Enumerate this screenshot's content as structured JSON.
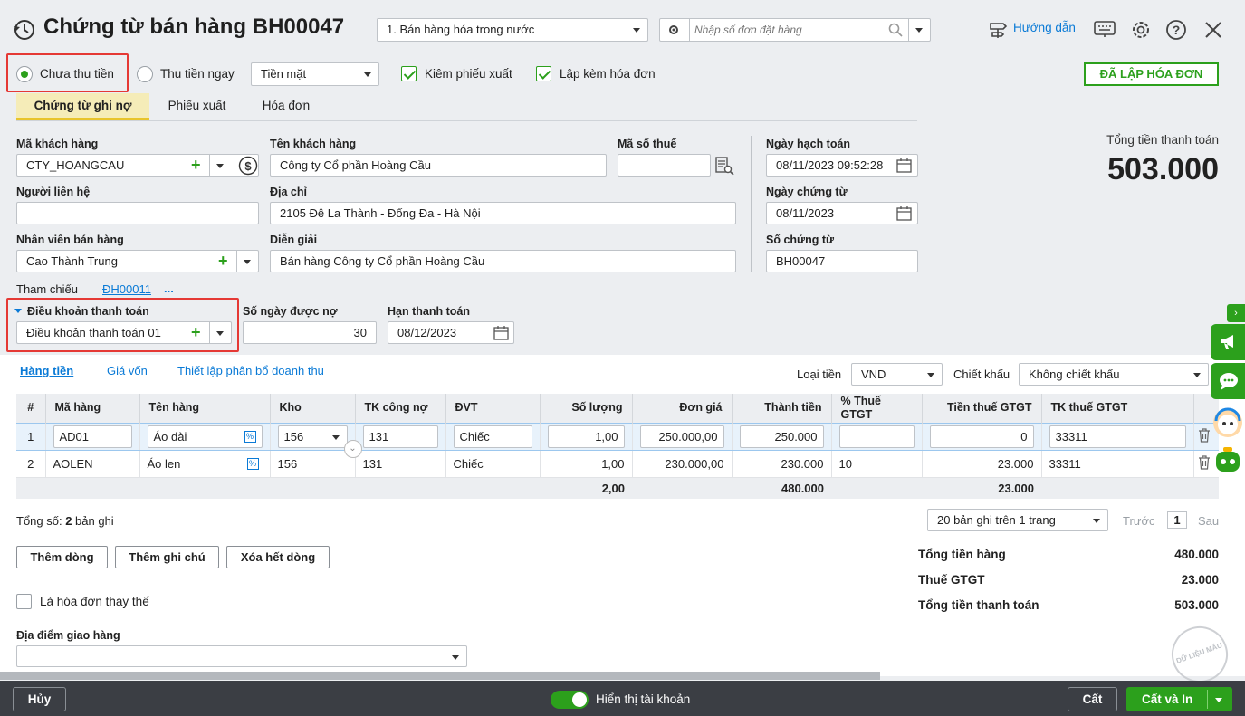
{
  "header": {
    "title": "Chứng từ bán hàng BH00047",
    "sale_type": "1. Bán hàng hóa trong nước",
    "order_search_placeholder": "Nhập số đơn đặt hàng",
    "help_label": "Hướng dẫn"
  },
  "payment": {
    "unpaid_label": "Chưa thu tiền",
    "paid_label": "Thu tiền ngay",
    "method": "Tiền mặt",
    "with_delivery_label": "Kiêm phiếu xuất",
    "with_invoice_label": "Lập kèm hóa đơn",
    "invoice_status": "ĐÃ LẬP HÓA ĐƠN"
  },
  "tabs": [
    "Chứng từ ghi nợ",
    "Phiếu xuất",
    "Hóa đơn"
  ],
  "form": {
    "customer_code_label": "Mã khách hàng",
    "customer_code": "CTY_HOANGCAU",
    "customer_name_label": "Tên khách hàng",
    "customer_name": "Công ty Cổ phần Hoàng Cầu",
    "tax_code_label": "Mã số thuế",
    "tax_code": "",
    "contact_label": "Người liên hệ",
    "contact": "",
    "address_label": "Địa chỉ",
    "address": "2105 Đê La Thành - Đống Đa - Hà Nội",
    "salesperson_label": "Nhân viên bán hàng",
    "salesperson": "Cao Thành Trung",
    "description_label": "Diễn giải",
    "description": "Bán hàng Công ty Cổ phần Hoàng Cầu",
    "posting_date_label": "Ngày hạch toán",
    "posting_date": "08/11/2023 09:52:28",
    "voucher_date_label": "Ngày chứng từ",
    "voucher_date": "08/11/2023",
    "voucher_no_label": "Số chứng từ",
    "voucher_no": "BH00047",
    "reference_label": "Tham chiếu",
    "reference": "ĐH00011",
    "reference_more": "...",
    "payment_terms_label": "Điều khoản thanh toán",
    "payment_terms": "Điều khoản thanh toán 01",
    "credit_days_label": "Số ngày được nợ",
    "credit_days": "30",
    "due_date_label": "Hạn thanh toán",
    "due_date": "08/12/2023"
  },
  "summary_top": {
    "total_label": "Tổng tiền thanh toán",
    "total": "503.000"
  },
  "detail_tabs": [
    "Hàng tiền",
    "Giá vốn",
    "Thiết lập phân bổ doanh thu"
  ],
  "currency_label": "Loại tiền",
  "currency": "VND",
  "discount_label": "Chiết khấu",
  "discount": "Không chiết khấu",
  "table": {
    "columns": [
      "#",
      "Mã hàng",
      "Tên hàng",
      "Kho",
      "TK công nợ",
      "ĐVT",
      "Số lượng",
      "Đơn giá",
      "Thành tiền",
      "% Thuế GTGT",
      "Tiền thuế GTGT",
      "TK thuế GTGT"
    ],
    "rows": [
      [
        "1",
        "AD01",
        "Áo dài",
        "156",
        "131",
        "Chiếc",
        "1,00",
        "250.000,00",
        "250.000",
        "",
        "0",
        "33311"
      ],
      [
        "2",
        "AOLEN",
        "Áo len",
        "156",
        "131",
        "Chiếc",
        "1,00",
        "230.000,00",
        "230.000",
        "10",
        "23.000",
        "33311"
      ]
    ],
    "totals": {
      "quantity": "2,00",
      "amount": "480.000",
      "vat": "23.000"
    }
  },
  "record_count_prefix": "Tổng số: ",
  "record_count": "2",
  "record_count_suffix": " bản ghi",
  "pager": {
    "per_page": "20 bản ghi trên 1 trang",
    "prev": "Trước",
    "page": "1",
    "next": "Sau"
  },
  "buttons": {
    "add_row": "Thêm dòng",
    "add_note": "Thêm ghi chú",
    "delete_all": "Xóa hết dòng"
  },
  "replacement_invoice_label": "Là hóa đơn thay thế",
  "delivery_place_label": "Địa điểm giao hàng",
  "totals": {
    "goods_label": "Tổng tiền hàng",
    "goods": "480.000",
    "vat_label": "Thuế GTGT",
    "vat": "23.000",
    "payment_label": "Tổng tiền thanh toán",
    "payment": "503.000"
  },
  "footer": {
    "cancel": "Hủy",
    "show_accounts_label": "Hiển thị tài khoản",
    "save": "Cất",
    "save_print": "Cất và In"
  },
  "watermark": "DỮ LIỆU MẪU",
  "colors": {
    "accent": "#2ca01c",
    "link": "#0a7ad6",
    "highlight": "#e53935",
    "footer": "#3b3e44"
  }
}
